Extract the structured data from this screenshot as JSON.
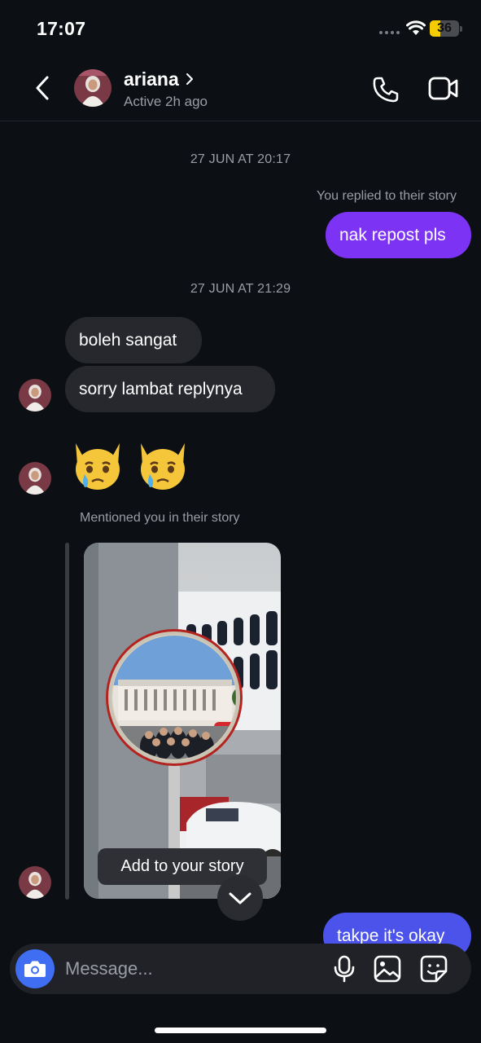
{
  "status_bar": {
    "time": "17:07",
    "battery": "36",
    "battery_level": 0.36
  },
  "header": {
    "contact_name": "ariana",
    "contact_status": "Active 2h ago"
  },
  "thread": {
    "timestamp_1": "27 JUN AT 20:17",
    "reply_note": "You replied to their story",
    "outgoing_1": "nak repost pls",
    "timestamp_2": "27 JUN AT 21:29",
    "incoming_1": "boleh sangat",
    "incoming_2": "sorry lambat replynya",
    "incoming_emoji": "😿😿",
    "mention_note": "Mentioned you in their story",
    "add_story_label": "Add to your story",
    "outgoing_2": "takpe it's okay"
  },
  "composer": {
    "placeholder": "Message..."
  },
  "colors": {
    "outgoing_bubble": "#7d33f3",
    "incoming_bubble": "#26282d",
    "camera_button": "#3f6ef2",
    "background": "#0c0f14"
  },
  "icons": [
    "back-arrow-icon",
    "chevron-right-icon",
    "phone-icon",
    "video-camera-icon",
    "camera-icon",
    "microphone-icon",
    "gallery-icon",
    "sticker-icon",
    "chevron-down-icon",
    "wifi-icon",
    "battery-icon",
    "signal-icon"
  ]
}
